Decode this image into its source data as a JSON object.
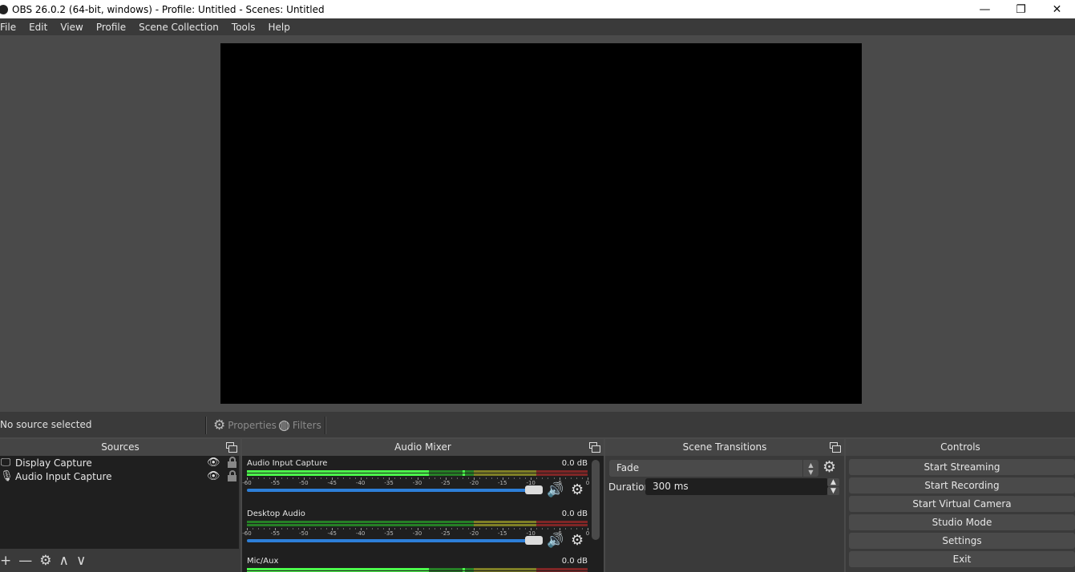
{
  "window": {
    "title": "OBS 26.0.2 (64-bit, windows) - Profile: Untitled - Scenes: Untitled",
    "controls": {
      "minimize": "—",
      "restore": "❐",
      "close": "✕"
    }
  },
  "menu": [
    "File",
    "Edit",
    "View",
    "Profile",
    "Scene Collection",
    "Tools",
    "Help"
  ],
  "source_bar": {
    "status": "No source selected",
    "properties_label": "Properties",
    "filters_label": "Filters",
    "gear_glyph": "⚙",
    "filters_glyph": "◍"
  },
  "sources": {
    "title": "Sources",
    "items": [
      {
        "name": "Display Capture",
        "icon": "monitor-icon",
        "glyph": "🖵",
        "visible": true,
        "locked": false
      },
      {
        "name": "Audio Input Capture",
        "icon": "microphone-icon",
        "glyph": "🎙",
        "visible": true,
        "locked": false
      }
    ],
    "eye_glyph": "👁",
    "toolbar": {
      "add": "+",
      "remove": "—",
      "settings": "⚙",
      "up": "∧",
      "down": "∨"
    }
  },
  "audio_mixer": {
    "title": "Audio Mixer",
    "scale_ticks": [
      "-60",
      "-55",
      "-50",
      "-45",
      "-40",
      "-35",
      "-30",
      "-25",
      "-20",
      "-15",
      "-10",
      "-5",
      "0"
    ],
    "channels": [
      {
        "name": "Audio Input Capture",
        "level": "0.0 dB",
        "volume_percent": 100,
        "meter_peak_db": -28,
        "peak_hold_db": -22
      },
      {
        "name": "Desktop Audio",
        "level": "0.0 dB",
        "volume_percent": 100,
        "meter_peak_db": -60,
        "peak_hold_db": null
      },
      {
        "name": "Mic/Aux",
        "level": "0.0 dB",
        "volume_percent": 100,
        "meter_peak_db": -28,
        "peak_hold_db": -22
      }
    ],
    "speaker_glyph": "🔊",
    "gear_glyph": "⚙"
  },
  "scene_transitions": {
    "title": "Scene Transitions",
    "selected": "Fade",
    "duration_label": "Duration",
    "duration_value": "300 ms",
    "spin_up": "⌃",
    "spin_down": "⌄",
    "gear_glyph": "⚙"
  },
  "controls": {
    "title": "Controls",
    "buttons": [
      "Start Streaming",
      "Start Recording",
      "Start Virtual Camera",
      "Studio Mode",
      "Settings",
      "Exit"
    ]
  },
  "colors": {
    "meter_green": "#4cff4c",
    "meter_green_dim": "#267f26",
    "meter_yellow_dim": "#7f7f26",
    "meter_red_dim": "#7f2626",
    "fader_blue": "#2d7fd8"
  }
}
